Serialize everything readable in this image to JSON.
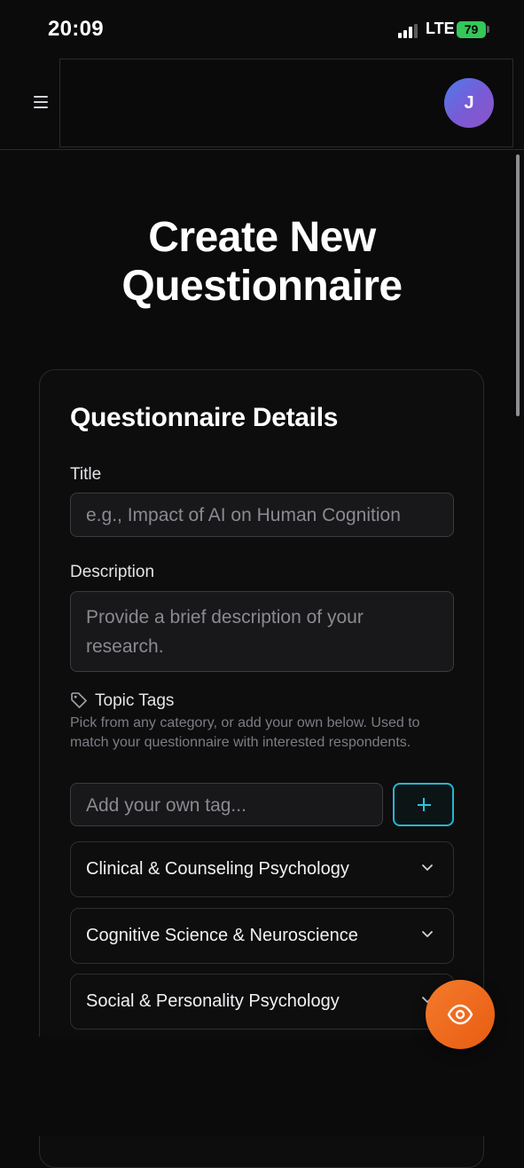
{
  "status_bar": {
    "time": "20:09",
    "network": "LTE",
    "battery": "79"
  },
  "header": {
    "avatar_initial": "J"
  },
  "page": {
    "title": "Create New Questionnaire"
  },
  "details": {
    "heading": "Questionnaire Details",
    "title_label": "Title",
    "title_placeholder": "e.g., Impact of AI on Human Cognition",
    "description_label": "Description",
    "description_placeholder": "Provide a brief description of your research.",
    "tags_label": "Topic Tags",
    "tags_hint": "Pick from any category, or add your own below. Used to match your questionnaire with interested respondents.",
    "tag_input_placeholder": "Add your own tag..."
  },
  "categories": [
    {
      "label": "Clinical & Counseling Psychology"
    },
    {
      "label": "Cognitive Science & Neuroscience"
    },
    {
      "label": "Social & Personality Psychology"
    }
  ],
  "colors": {
    "accent_cyan": "#22b8cf",
    "fab_orange": "#ee6a1f",
    "battery_green": "#34c759"
  }
}
